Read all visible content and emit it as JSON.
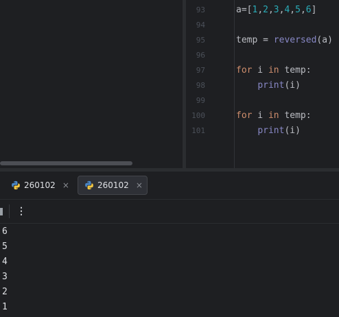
{
  "editor": {
    "lines": [
      {
        "num": "93",
        "tokens": [
          {
            "t": "a=[",
            "c": "#bcbec4"
          },
          {
            "t": "1",
            "c": "#2aacb8"
          },
          {
            "t": ",",
            "c": "#bcbec4"
          },
          {
            "t": "2",
            "c": "#2aacb8"
          },
          {
            "t": ",",
            "c": "#bcbec4"
          },
          {
            "t": "3",
            "c": "#2aacb8"
          },
          {
            "t": ",",
            "c": "#bcbec4"
          },
          {
            "t": "4",
            "c": "#2aacb8"
          },
          {
            "t": ",",
            "c": "#bcbec4"
          },
          {
            "t": "5",
            "c": "#2aacb8"
          },
          {
            "t": ",",
            "c": "#bcbec4"
          },
          {
            "t": "6",
            "c": "#2aacb8"
          },
          {
            "t": "]",
            "c": "#bcbec4"
          }
        ]
      },
      {
        "num": "94",
        "tokens": []
      },
      {
        "num": "95",
        "tokens": [
          {
            "t": "temp = ",
            "c": "#bcbec4"
          },
          {
            "t": "reversed",
            "c": "#8888c6"
          },
          {
            "t": "(a)",
            "c": "#bcbec4"
          }
        ]
      },
      {
        "num": "96",
        "tokens": []
      },
      {
        "num": "97",
        "tokens": [
          {
            "t": "for",
            "c": "#cf8e6d"
          },
          {
            "t": " i ",
            "c": "#bcbec4"
          },
          {
            "t": "in",
            "c": "#cf8e6d"
          },
          {
            "t": " temp:",
            "c": "#bcbec4"
          }
        ]
      },
      {
        "num": "98",
        "tokens": [
          {
            "t": "    ",
            "c": "#bcbec4"
          },
          {
            "t": "print",
            "c": "#8888c6"
          },
          {
            "t": "(i)",
            "c": "#bcbec4"
          }
        ]
      },
      {
        "num": "99",
        "tokens": []
      },
      {
        "num": "100",
        "tokens": [
          {
            "t": "for",
            "c": "#cf8e6d"
          },
          {
            "t": " i ",
            "c": "#bcbec4"
          },
          {
            "t": "in",
            "c": "#cf8e6d"
          },
          {
            "t": " temp:",
            "c": "#bcbec4"
          }
        ]
      },
      {
        "num": "101",
        "tokens": [
          {
            "t": "    ",
            "c": "#bcbec4"
          },
          {
            "t": "print",
            "c": "#8888c6"
          },
          {
            "t": "(i)",
            "c": "#bcbec4"
          }
        ]
      }
    ]
  },
  "run_tabs": [
    {
      "label": "260102",
      "close": "×",
      "icon": "python-icon",
      "active": false
    },
    {
      "label": "260102",
      "close": "×",
      "icon": "python-icon",
      "active": true
    }
  ],
  "toolbar": {
    "more_label": "⋮"
  },
  "console": {
    "output": [
      "6",
      "5",
      "4",
      "3",
      "2",
      "1"
    ]
  }
}
